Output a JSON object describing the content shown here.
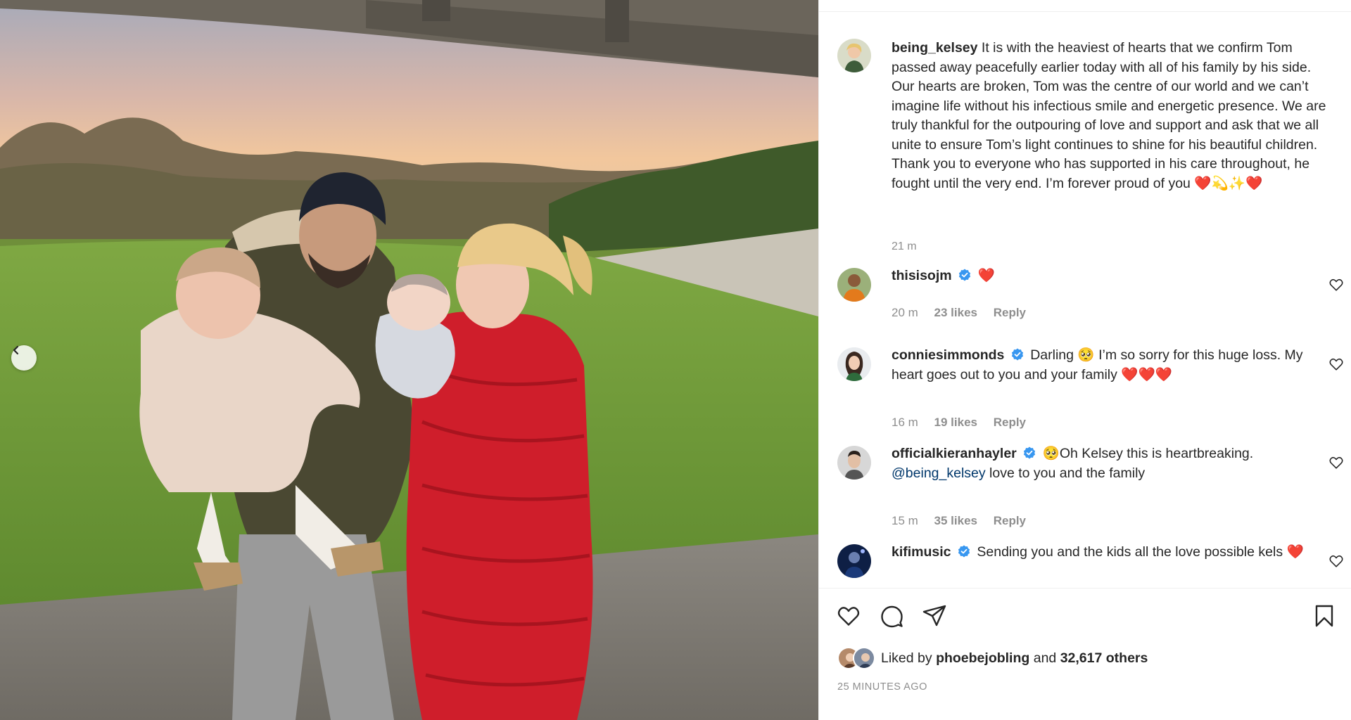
{
  "photo": {
    "alt": "Family photo in a field at sunset",
    "prev_label": "Previous"
  },
  "caption": {
    "username": "being_kelsey",
    "text": "It is with the heaviest of hearts that we confirm Tom passed away peacefully earlier today with all of his family by his side. Our hearts are broken, Tom was the centre of our world and we can’t imagine life without his infectious smile and energetic presence. We are truly thankful for the outpouring of love and support and ask that we all unite to ensure Tom’s light continues to shine for his beautiful children. Thank you to everyone who has supported in his care throughout, he fought until the very end. I’m forever proud of you",
    "emoji": "❤️💫✨❤️",
    "time": "21 m"
  },
  "comments": [
    {
      "username": "thisisojm",
      "verified": true,
      "text": "❤️",
      "time": "20 m",
      "likes": "23 likes",
      "reply": "Reply"
    },
    {
      "username": "conniesimmonds",
      "verified": true,
      "text": "Darling 🥺 I’m so sorry for this huge loss. My heart goes out to you and your family ❤️❤️❤️",
      "time": "16 m",
      "likes": "19 likes",
      "reply": "Reply"
    },
    {
      "username": "officialkieranhayler",
      "verified": true,
      "text_prefix": "🥺Oh Kelsey this is heartbreaking.",
      "mention": "@being_kelsey",
      "text_suffix": "love to you and the family",
      "time": "15 m",
      "likes": "35 likes",
      "reply": "Reply"
    },
    {
      "username": "kifimusic",
      "verified": true,
      "text": "Sending you and the kids all the love possible kels ❤️"
    }
  ],
  "likes": {
    "prefix": "Liked by",
    "user": "phoebejobling",
    "middle": "and",
    "count": "32,617 others"
  },
  "posted": "25 MINUTES AGO",
  "colors": {
    "text": "#262626",
    "muted": "#8e8e8e",
    "verified": "#3897f0",
    "mention": "#00376b",
    "border": "#efefef"
  },
  "icons": [
    "heart-icon",
    "comment-icon",
    "share-icon",
    "bookmark-icon",
    "verified-icon",
    "chevron-left-icon"
  ]
}
